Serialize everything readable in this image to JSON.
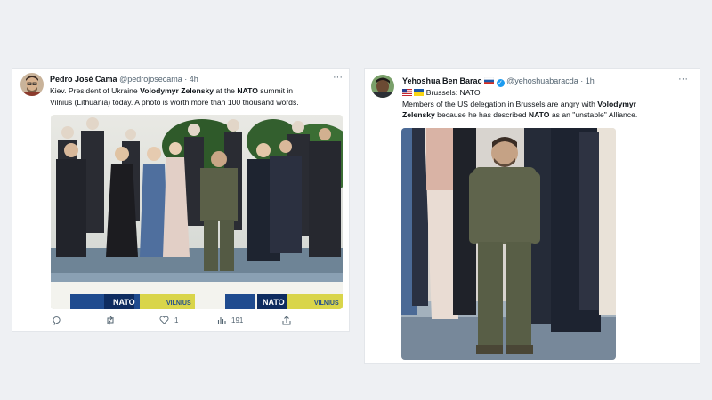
{
  "tweet1": {
    "author_name": "Pedro José Cama",
    "handle": "@pedrojosecama",
    "sep": " · ",
    "time": "4h",
    "more": "···",
    "text_line1_pre": "Kiev. President of Ukraine ",
    "text_line1_bold1": "Volodymyr Zelensky",
    "text_line1_mid": " at the ",
    "text_line1_bold2": "NATO",
    "text_line1_post": " summit in",
    "text_line2": "Vilnius (Lithuania) today. A photo is worth more than 100 thousand words.",
    "banner_nato": "NATO",
    "banner_vilnius": "VILNIUS",
    "actions": {
      "replies": "",
      "retweets": "",
      "likes": "1",
      "views": "191"
    }
  },
  "tweet2": {
    "author_name": "Yehoshua Ben Barac",
    "handle": "@yehoshuabaracda",
    "sep": " · ",
    "time": "1h",
    "more": "···",
    "text_line1": "Brussels: NATO",
    "text_line2_pre": "Members of the US delegation in Brussels are angry with ",
    "text_line2_bold": "Volodymyr",
    "text_line3_bold1": "Zelensky",
    "text_line3_mid": " because he has described ",
    "text_line3_bold2": "NATO",
    "text_line3_post": " as an \"unstable\" Alliance."
  },
  "icons": {
    "reply": "reply-icon",
    "retweet": "retweet-icon",
    "like": "heart-icon",
    "views": "views-icon",
    "share": "share-icon",
    "verified": "verified-badge-icon"
  },
  "colors": {
    "background": "#eef0f3",
    "card": "#ffffff",
    "muted": "#536471",
    "verified": "#1d9bf0"
  }
}
